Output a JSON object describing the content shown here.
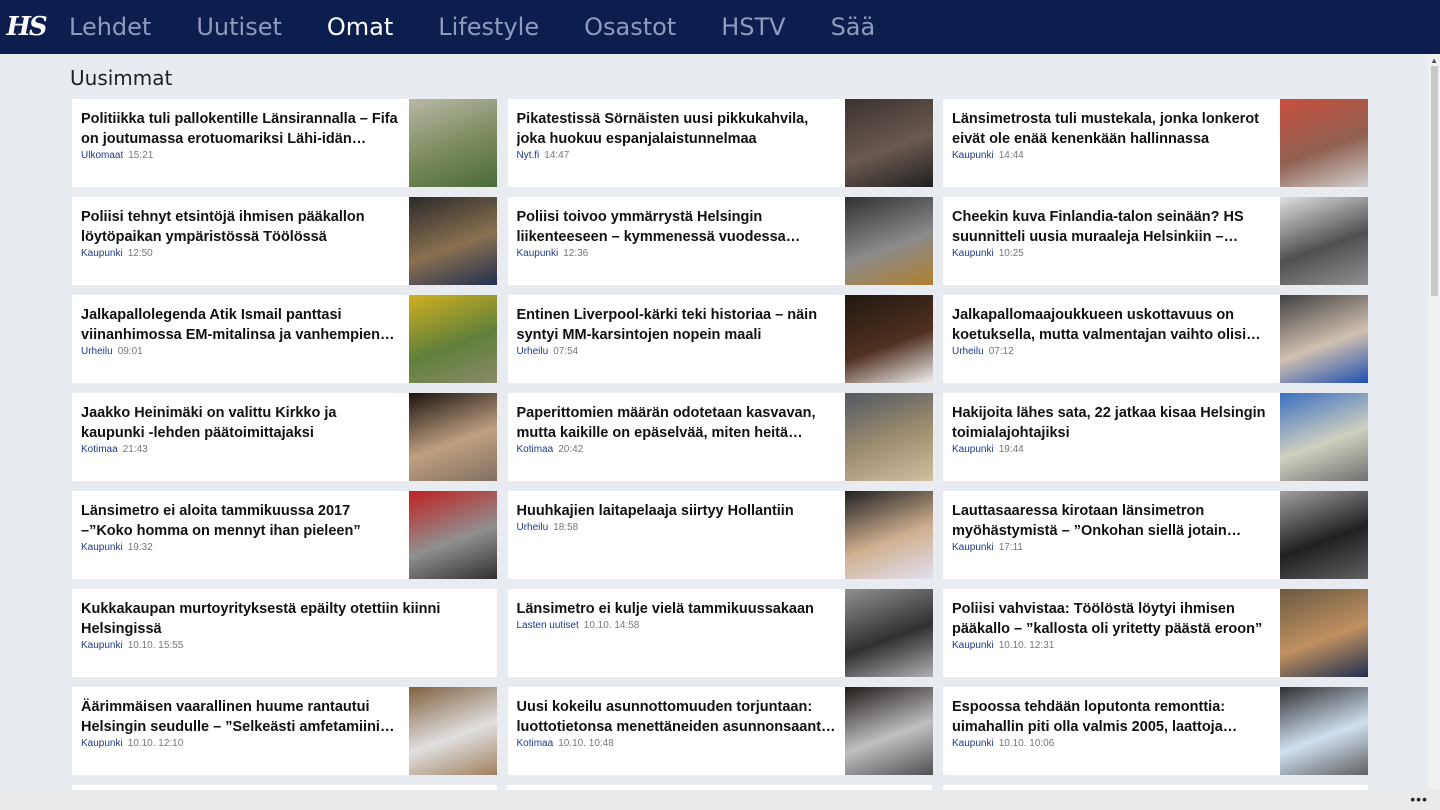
{
  "nav": {
    "logo": "HS",
    "items": [
      "Lehdet",
      "Uutiset",
      "Omat",
      "Lifestyle",
      "Osastot",
      "HSTV",
      "Sää"
    ],
    "active": "Omat"
  },
  "section": {
    "title": "Uusimmat"
  },
  "articles": [
    {
      "headline": "Politiikka tuli pallokentille Länsirannalla – Fifa on joutumassa erotuomariksi Lähi-idän konfliktiin",
      "category": "Ulkomaat",
      "time": "15:21",
      "thumb": [
        "#b8b8a8",
        "#7a8a5a",
        "#4a6a3a"
      ]
    },
    {
      "headline": "Pikatestissä Sörnäisten uusi pikkukahvila, joka huokuu espanjalaistunnelmaa",
      "category": "Nyt.fi",
      "time": "14:47",
      "thumb": [
        "#3a3230",
        "#6a5a50",
        "#202020"
      ]
    },
    {
      "headline": "Länsimetrosta tuli mustekala, jonka lonkerot eivät ole enää kenenkään hallinnassa",
      "category": "Kaupunki",
      "time": "14:44",
      "thumb": [
        "#c85040",
        "#906050",
        "#d0d0d0"
      ]
    },
    {
      "headline": "Poliisi tehnyt etsintöjä ihmisen pääkallon löytöpaikan ympäristössä Töölössä",
      "category": "Kaupunki",
      "time": "12:50",
      "thumb": [
        "#2a2a2a",
        "#8a7050",
        "#203050"
      ]
    },
    {
      "headline": "Poliisi toivoo ymmärrystä Helsingin liikenteeseen – kymmenessä vuodessa asukasluku kasvaa",
      "category": "Kaupunki",
      "time": "12:36",
      "thumb": [
        "#303030",
        "#8a8a8a",
        "#b08030"
      ]
    },
    {
      "headline": "Cheekin kuva Finlandia-talon seinään? HS suunnitteli uusia muraaleja Helsinkiin – ehdota omasi",
      "category": "Kaupunki",
      "time": "10:25",
      "thumb": [
        "#e0e0e0",
        "#505050",
        "#909090"
      ]
    },
    {
      "headline": "Jalkapallolegenda Atik Ismail panttasi viinanhimossa EM-mitalinsa ja vanhempiensa kodin",
      "category": "Urheilu",
      "time": "09:01",
      "thumb": [
        "#d0b020",
        "#60803a",
        "#8a8a6a"
      ]
    },
    {
      "headline": "Entinen Liverpool-kärki teki historiaa – näin syntyi MM-karsintojen nopein maali",
      "category": "Urheilu",
      "time": "07:54",
      "thumb": [
        "#201810",
        "#503020",
        "#f0f0f0"
      ]
    },
    {
      "headline": "Jalkapallomaajoukkueen uskottavuus on koetuksella, mutta valmentajan vaihto olisi virhe",
      "category": "Urheilu",
      "time": "07:12",
      "thumb": [
        "#404040",
        "#d0c0b0",
        "#2050b0"
      ]
    },
    {
      "headline": "Jaakko Heinimäki on valittu Kirkko ja kaupunki -lehden päätoimittajaksi",
      "category": "Kotimaa",
      "time": "21:43",
      "thumb": [
        "#1a1410",
        "#c0a080",
        "#807060"
      ]
    },
    {
      "headline": "Paperittomien määrän odotetaan kasvavan, mutta kaikille on epäselvää, miten heitä autetaan",
      "category": "Kotimaa",
      "time": "20:42",
      "thumb": [
        "#505860",
        "#a09070",
        "#d0c0a0"
      ]
    },
    {
      "headline": "Hakijoita lähes sata, 22 jatkaa kisaa Helsingin toimialajohtajiksi",
      "category": "Kaupunki",
      "time": "19:44",
      "thumb": [
        "#3a70c0",
        "#d0d0c0",
        "#707070"
      ]
    },
    {
      "headline": "Länsimetro ei aloita tammikuussa 2017 –”Koko homma on mennyt ihan pieleen”",
      "category": "Kaupunki",
      "time": "19:32",
      "thumb": [
        "#c02020",
        "#909090",
        "#303030"
      ]
    },
    {
      "headline": "Huuhkajien laitapelaaja siirtyy Hollantiin",
      "category": "Urheilu",
      "time": "18:58",
      "thumb": [
        "#202020",
        "#d0b090",
        "#e0e0f0"
      ]
    },
    {
      "headline": "Lauttasaaressa kirotaan länsimetron myöhästymistä – ”Onkohan siellä jotain kuppaa?”",
      "category": "Kaupunki",
      "time": "17:11",
      "thumb": [
        "#a0a0a0",
        "#202020",
        "#606060"
      ]
    },
    {
      "headline": "Kukkakaupan murtoyrityksestä epäilty otettiin kiinni Helsingissä",
      "category": "Kaupunki",
      "time": "10.10. 15:55",
      "thumb": null
    },
    {
      "headline": "Länsimetro ei kulje vielä tammikuussakaan",
      "category": "Lasten uutiset",
      "time": "10.10. 14:58",
      "thumb": [
        "#909090",
        "#303030",
        "#b0b0b0"
      ]
    },
    {
      "headline": "Poliisi vahvistaa: Töölöstä löytyi ihmisen pääkallo – ”kallosta oli yritetty päästä eroon”",
      "category": "Kaupunki",
      "time": "10.10. 12:31",
      "thumb": [
        "#6a5a40",
        "#c09060",
        "#203050"
      ]
    },
    {
      "headline": "Äärimmäisen vaarallinen huume rantautui Helsingin seudulle – ”Selkeästi amfetamiinia vahvempaa”",
      "category": "Kaupunki",
      "time": "10.10. 12:10",
      "thumb": [
        "#806040",
        "#e0e0e0",
        "#a08060"
      ]
    },
    {
      "headline": "Uusi kokeilu asunnottomuuden torjuntaan: luottotietonsa menettäneiden asunnonsaanti helpottuu",
      "category": "Kotimaa",
      "time": "10.10. 10:48",
      "thumb": [
        "#201a18",
        "#c0c0c0",
        "#505050"
      ]
    },
    {
      "headline": "Espoossa tehdään loputonta remonttia: uimahallin piti olla valmis 2005, laattoja uusitaan yhä",
      "category": "Kaupunki",
      "time": "10.10. 10:06",
      "thumb": [
        "#303030",
        "#d0e0f0",
        "#606060"
      ]
    }
  ]
}
